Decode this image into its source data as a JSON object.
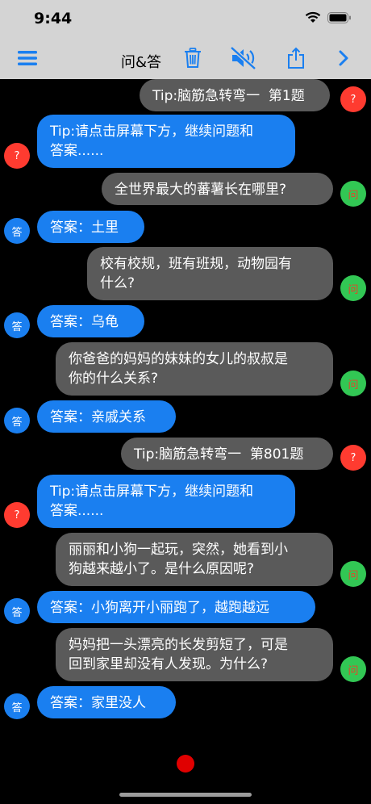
{
  "status": {
    "time": "9:44"
  },
  "nav": {
    "title": "问&答",
    "icons": {
      "menu": "hamburger-menu-icon",
      "trash": "trash-icon",
      "mute": "speaker-muted-icon",
      "share": "share-icon",
      "next": "chevron-right-icon"
    },
    "accent": "#1a7ff0"
  },
  "messages": [
    {
      "type": "tip",
      "text": "Tip:脑筋急转弯一  第1题",
      "avatar": "?"
    },
    {
      "type": "tip-answer",
      "text": "Tip:请点击屏幕下方，继续问题和\n答案......",
      "avatar": "?"
    },
    {
      "type": "question",
      "text": "全世界最大的蕃薯长在哪里?",
      "avatar": "问"
    },
    {
      "type": "answer",
      "text": "答案：土里",
      "avatar": "答"
    },
    {
      "type": "question",
      "text": "校有校规，班有班规，动物园有\n什么?",
      "avatar": "问"
    },
    {
      "type": "answer",
      "text": "答案：乌龟",
      "avatar": "答"
    },
    {
      "type": "question",
      "text": "你爸爸的妈妈的妹妹的女儿的叔叔是\n你的什么关系?",
      "avatar": "问"
    },
    {
      "type": "answer",
      "text": "答案：亲戚关系",
      "avatar": "答"
    },
    {
      "type": "tip",
      "text": "Tip:脑筋急转弯一  第801题",
      "avatar": "?"
    },
    {
      "type": "tip-answer",
      "text": "Tip:请点击屏幕下方，继续问题和\n答案......",
      "avatar": "?"
    },
    {
      "type": "question",
      "text": "丽丽和小狗一起玩，突然，她看到小\n狗越来越小了。是什么原因呢?",
      "avatar": "问"
    },
    {
      "type": "answer",
      "text": "答案：小狗离开小丽跑了，越跑越远",
      "avatar": "答"
    },
    {
      "type": "question",
      "text": "妈妈把一头漂亮的长发剪短了，可是\n回到家里却没有人发现。为什么?",
      "avatar": "问"
    },
    {
      "type": "answer",
      "text": "答案：家里没人",
      "avatar": "答"
    }
  ],
  "colors": {
    "question_bubble": "#5a5a5a",
    "answer_bubble": "#1a7ff0",
    "tip_avatar": "#ff3b30",
    "question_avatar": "#32c754",
    "record_button": "#e00000"
  }
}
